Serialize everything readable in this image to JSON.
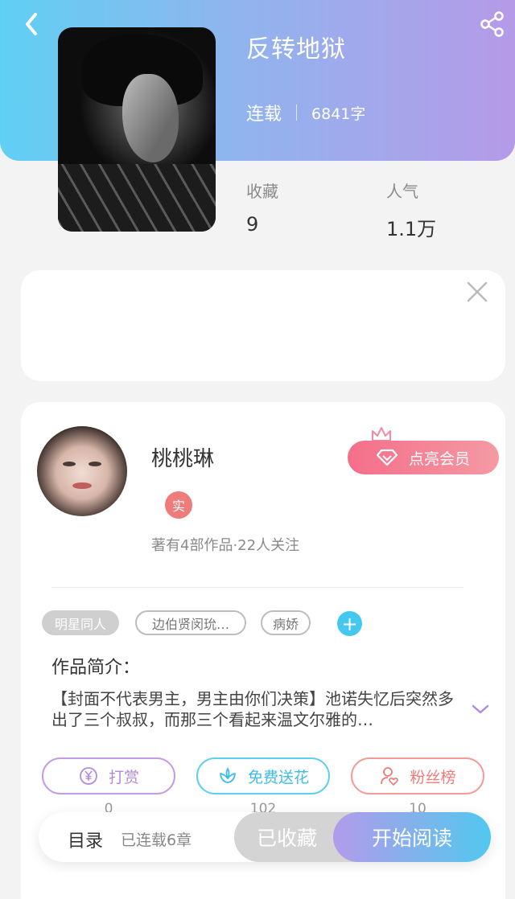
{
  "header": {
    "title": "反转地狱",
    "status": "连载",
    "word_count": "6841字",
    "stats": [
      {
        "label": "收藏",
        "value": "9"
      },
      {
        "label": "人气",
        "value": "1.1万"
      }
    ]
  },
  "icons": {
    "back": "back-arrow-icon",
    "share": "share-icon",
    "close": "close-icon",
    "vip": "diamond-icon",
    "crown": "crown-icon",
    "expand": "chevron-down-icon",
    "reward": "yen-coin-icon",
    "flower": "flower-icon",
    "fans": "user-heart-icon"
  },
  "author": {
    "name": "桃桃琳",
    "verified_badge": "实",
    "meta": "著有4部作品·22人关注",
    "vip_button": "点亮会员"
  },
  "tags": [
    "明星同人",
    "边伯贤闵玧…",
    "病娇"
  ],
  "tag_add": "+",
  "synopsis": {
    "title": "作品简介：",
    "text": "【封面不代表男主，男主由你们决策】池诺失忆后突然多出了三个叔叔，而那三个看起来温文尔雅的…"
  },
  "actions": [
    {
      "label": "打赏",
      "count": "0"
    },
    {
      "label": "免费送花",
      "count": "102"
    },
    {
      "label": "粉丝榜",
      "count": "10"
    }
  ],
  "bottom_bar": {
    "toc_label": "目录",
    "toc_status": "已连载6章",
    "collected_label": "已收藏",
    "read_label": "开始阅读"
  },
  "colors": {
    "header_gradient_start": "#5fd0f3",
    "header_gradient_end": "#b59ae8",
    "vip_pink": "#f56e8a",
    "accent_blue": "#46c7ee",
    "accent_purple": "#b28ae0"
  }
}
